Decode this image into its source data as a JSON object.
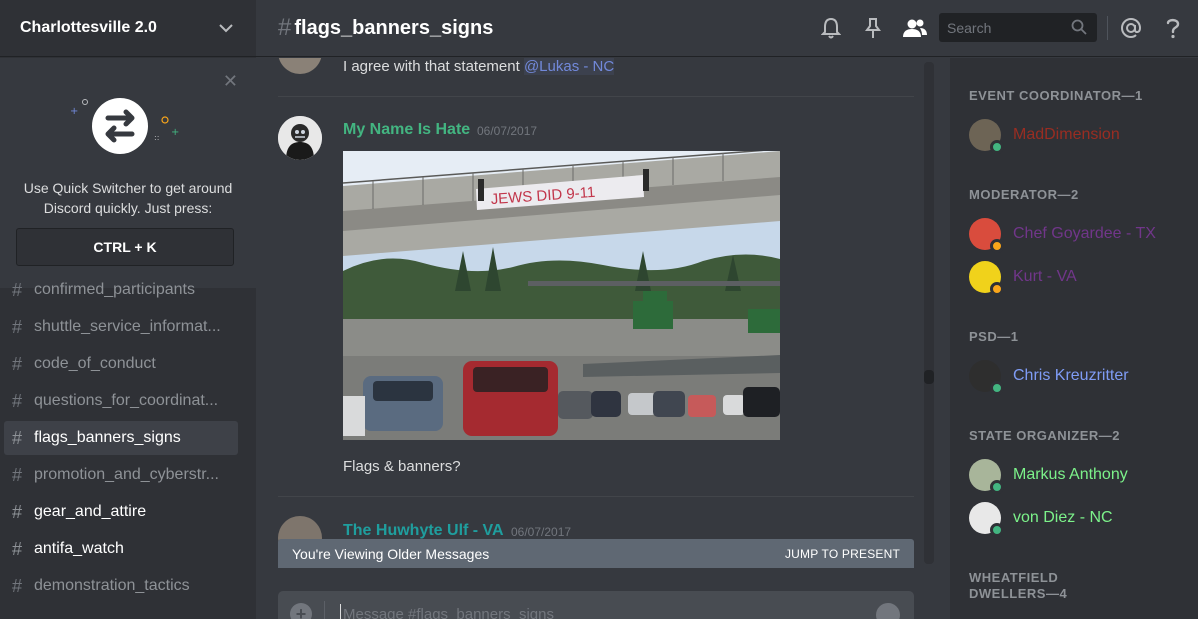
{
  "guild": {
    "name": "Charlottesville 2.0"
  },
  "quick_switcher": {
    "text": "Use Quick Switcher to get around Discord quickly. Just press:",
    "shortcut": "CTRL + K"
  },
  "channels": [
    {
      "label": "confirmed_participants",
      "state": "normal"
    },
    {
      "label": "shuttle_service_informat...",
      "state": "normal"
    },
    {
      "label": "code_of_conduct",
      "state": "normal"
    },
    {
      "label": "questions_for_coordinat...",
      "state": "normal"
    },
    {
      "label": "flags_banners_signs",
      "state": "active"
    },
    {
      "label": "promotion_and_cyberstr...",
      "state": "normal"
    },
    {
      "label": "gear_and_attire",
      "state": "unread"
    },
    {
      "label": "antifa_watch",
      "state": "unread"
    },
    {
      "label": "demonstration_tactics",
      "state": "normal"
    }
  ],
  "header": {
    "hash": "#",
    "channel_name": "flags_banners_signs",
    "search_placeholder": "Search"
  },
  "messages": [
    {
      "text": "I agree with that statement",
      "mention": "@Lukas - NC"
    },
    {
      "author": "My Name Is Hate",
      "author_color": "#43b581",
      "timestamp": "06/07/2017",
      "image_text": "JEWS DID 9-11",
      "text": "Flags & banners?"
    },
    {
      "author": "The Huwhyte Ulf - VA",
      "author_color": "#1f9e9e",
      "timestamp": "06/07/2017"
    }
  ],
  "older_messages": {
    "text": "You're Viewing Older Messages",
    "jump_label": "JUMP TO PRESENT"
  },
  "composer": {
    "placeholder": "Message #flags_banners_signs"
  },
  "member_list": {
    "groups": [
      {
        "role": "EVENT COORDINATOR—1",
        "members": [
          {
            "name": "MadDimension",
            "color": "#992d22",
            "status": "online"
          }
        ]
      },
      {
        "role": "MODERATOR—2",
        "members": [
          {
            "name": "Chef Goyardee - TX",
            "color": "#71368a",
            "status": "idle"
          },
          {
            "name": "Kurt - VA",
            "color": "#71368a",
            "status": "idle"
          }
        ]
      },
      {
        "role": "PSD—1",
        "members": [
          {
            "name": "Chris Kreuzritter",
            "color": "#7f9cf5",
            "status": "online"
          }
        ]
      },
      {
        "role": "STATE ORGANIZER—2",
        "members": [
          {
            "name": "Markus Anthony",
            "color": "#7cf28a",
            "status": "online"
          },
          {
            "name": "von Diez - NC",
            "color": "#7cf28a",
            "status": "online"
          }
        ]
      },
      {
        "role": "WHEATFIELD DWELLERS—4",
        "members": []
      }
    ]
  },
  "colors": {
    "online": "#43b581",
    "idle": "#faa61a",
    "mention": "#7289da"
  }
}
